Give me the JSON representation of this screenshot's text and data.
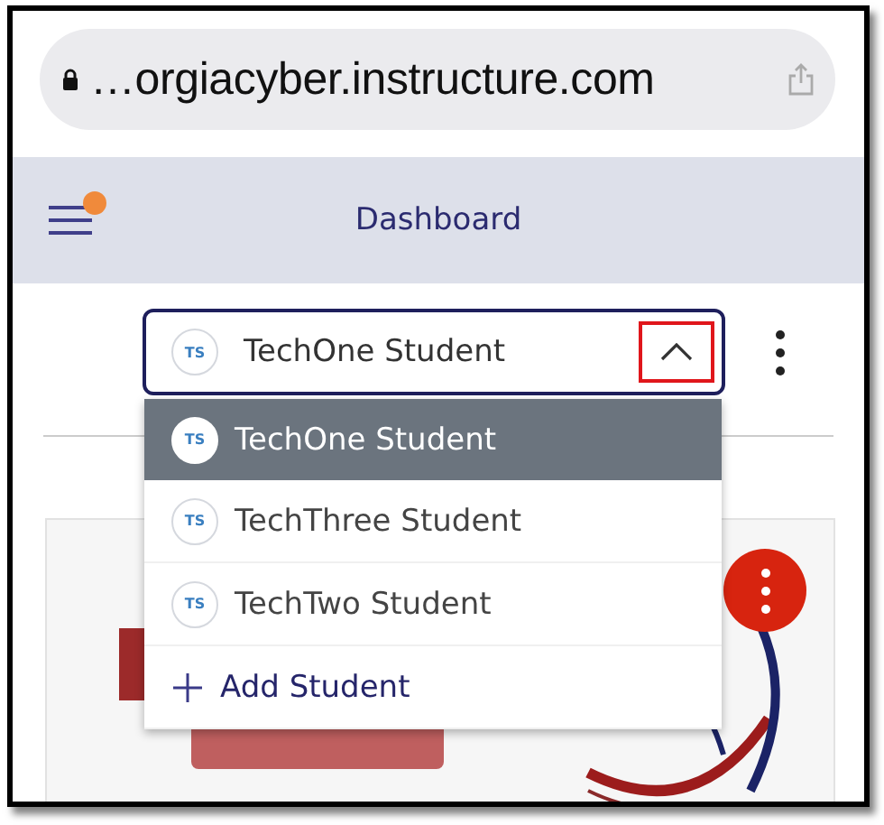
{
  "browser": {
    "url": "…orgiacyber.instructure.com"
  },
  "header": {
    "title": "Dashboard",
    "notification": true
  },
  "student_picker": {
    "initials": "TS",
    "value": "TechOne Student",
    "expanded": true,
    "highlighted_toggle": true
  },
  "menu": [
    {
      "kind": "student",
      "initials": "TS",
      "label": "TechOne Student",
      "selected": true
    },
    {
      "kind": "student",
      "initials": "TS",
      "label": "TechThree Student",
      "selected": false
    },
    {
      "kind": "student",
      "initials": "TS",
      "label": "TechTwo Student",
      "selected": false
    },
    {
      "kind": "add",
      "label": "Add Student",
      "selected": false
    }
  ]
}
